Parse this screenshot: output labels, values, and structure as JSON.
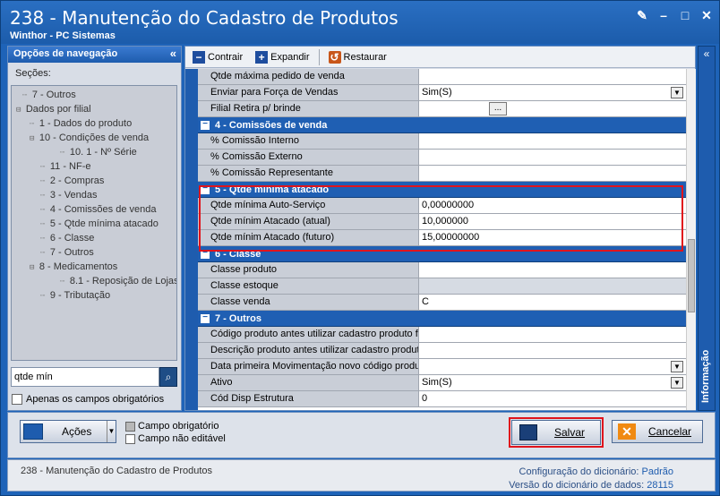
{
  "window": {
    "title": "238 - Manutenção do Cadastro de Produtos",
    "subtitle": "Winthor - PC Sistemas"
  },
  "nav": {
    "header": "Opções de navegação",
    "sections_label": "Seções:",
    "items": [
      {
        "label": "7 - Outros",
        "prefix": "┈"
      },
      {
        "label": "Dados por filial",
        "prefix": "⊟"
      },
      {
        "label": "1 - Dados do produto",
        "prefix": "┈"
      },
      {
        "label": "10 - Condições de venda",
        "prefix": "⊟"
      },
      {
        "label": "10. 1 - Nº Série",
        "prefix": "┈"
      },
      {
        "label": "11 - NF-e",
        "prefix": "┈"
      },
      {
        "label": "2 - Compras",
        "prefix": "┈"
      },
      {
        "label": "3 - Vendas",
        "prefix": "┈"
      },
      {
        "label": "4 - Comissões de venda",
        "prefix": "┈"
      },
      {
        "label": "5 - Qtde mínima atacado",
        "prefix": "┈"
      },
      {
        "label": "6 - Classe",
        "prefix": "┈"
      },
      {
        "label": "7 - Outros",
        "prefix": "┈"
      },
      {
        "label": "8 - Medicamentos",
        "prefix": "⊟"
      },
      {
        "label": "8.1 -  Reposição de Lojas",
        "prefix": "┈"
      },
      {
        "label": "9 - Tributação",
        "prefix": "┈"
      }
    ],
    "search_value": "qtde mín",
    "only_required_label": "Apenas os campos obrigatórios"
  },
  "toolbar": {
    "collapse": "Contrair",
    "expand": "Expandir",
    "restore": "Restaurar"
  },
  "grid": {
    "top_rows": [
      {
        "name": "Qtde máxima pedido de venda",
        "value": "",
        "control": ""
      },
      {
        "name": "Enviar para Força de Vendas",
        "value": "Sim(S)",
        "control": "dropdown"
      },
      {
        "name": "Filial Retira p/ brinde",
        "value": "",
        "control": "ellipsis"
      }
    ],
    "categories": [
      {
        "title": "4 - Comissões de venda",
        "rows": [
          {
            "name": "% Comissão Interno",
            "value": ""
          },
          {
            "name": "% Comissão Externo",
            "value": ""
          },
          {
            "name": "% Comissão Representante",
            "value": ""
          }
        ]
      },
      {
        "title": "5 - Qtde mínima atacado",
        "rows": [
          {
            "name": "Qtde mínima Auto-Serviço",
            "value": "0,00000000"
          },
          {
            "name": "Qtde mínim Atacado (atual)",
            "value": "10,000000"
          },
          {
            "name": "Qtde mínim Atacado (futuro)",
            "value": "15,00000000"
          }
        ]
      },
      {
        "title": "6 - Classe",
        "rows": [
          {
            "name": "Classe produto",
            "value": ""
          },
          {
            "name": "Classe estoque",
            "value": ""
          },
          {
            "name": "Classe venda",
            "value": "C"
          }
        ]
      },
      {
        "title": "7 - Outros",
        "rows": [
          {
            "name": "Código produto antes utilizar cadastro produto f",
            "value": ""
          },
          {
            "name": "Descrição produto antes utilizar cadastro produt",
            "value": ""
          },
          {
            "name": "Data primeira Movimentação novo código produ",
            "value": ""
          },
          {
            "name": "Ativo",
            "value": "Sim(S)"
          },
          {
            "name": "Cód Disp Estrutura",
            "value": "0"
          }
        ]
      }
    ]
  },
  "right_panel": {
    "label": "Informação"
  },
  "actions": {
    "acoes_label": "Ações",
    "legend_required": "Campo obrigatório",
    "legend_not_editable": "Campo não editável",
    "save_label": "Salvar",
    "cancel_label": "Cancelar"
  },
  "status": {
    "left": "238 - Manutenção do Cadastro de Produtos",
    "dict_config_label": "Configuração do dicionário:",
    "dict_config_value": "Padrão",
    "dict_version_label": "Versão do dicionário de dados:",
    "dict_version_value": "28115"
  },
  "colors": {
    "brand_blue": "#1e5cae",
    "highlight_red": "#e0141c",
    "cancel_orange": "#f08a12"
  }
}
